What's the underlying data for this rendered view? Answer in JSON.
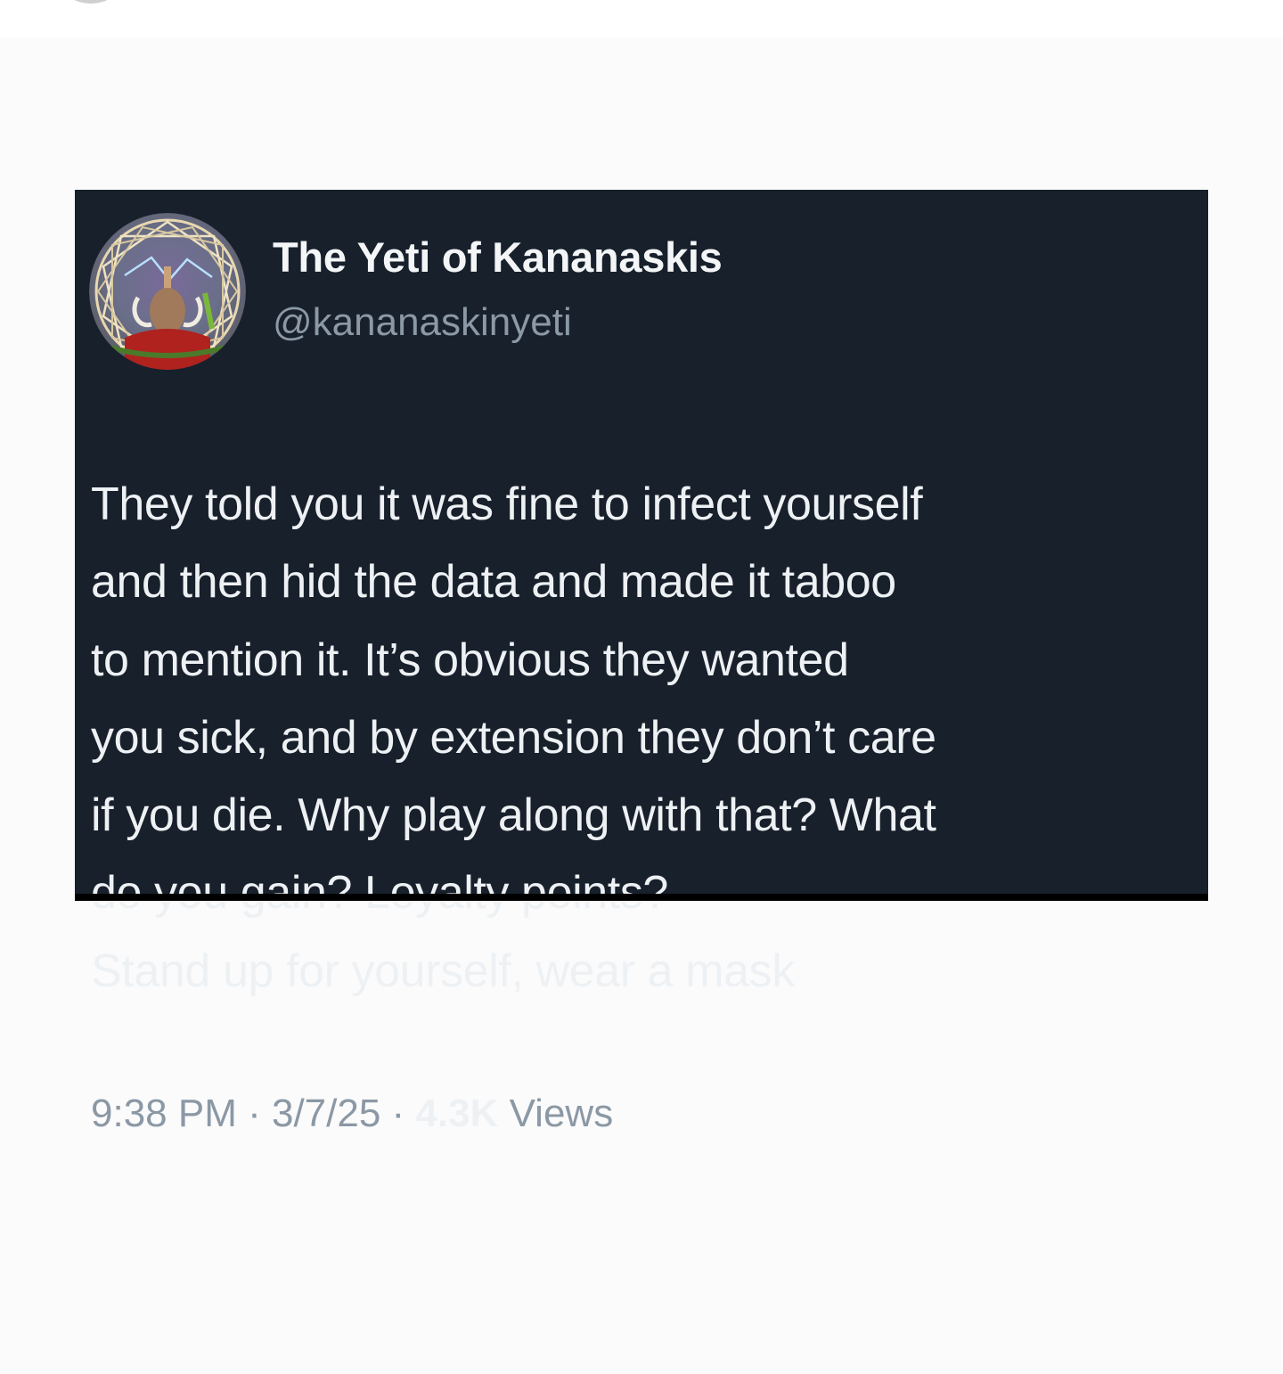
{
  "author": {
    "display_name": "The Yeti of Kananaskis",
    "handle": "@kananaskinyeti",
    "avatar_icon": "yeti-mandala-avatar-icon"
  },
  "tweet": {
    "lines": [
      "They told you it was fine to infect yourself",
      "and then hid the data and made it taboo",
      "to mention it. It’s obvious they wanted",
      "you sick, and by extension they don’t care",
      "if you die. Why play along with that? What",
      "do you gain? Loyalty points?",
      "Stand up for yourself, wear a mask"
    ]
  },
  "meta": {
    "time": "9:38 PM",
    "separator": " · ",
    "date": "3/7/25",
    "views_count": "4.3K",
    "views_label": " Views"
  },
  "colors": {
    "card_background": "#17202b",
    "page_background": "#fbfbfb",
    "primary_text": "#eef1f4",
    "secondary_text": "#8b98a5"
  }
}
